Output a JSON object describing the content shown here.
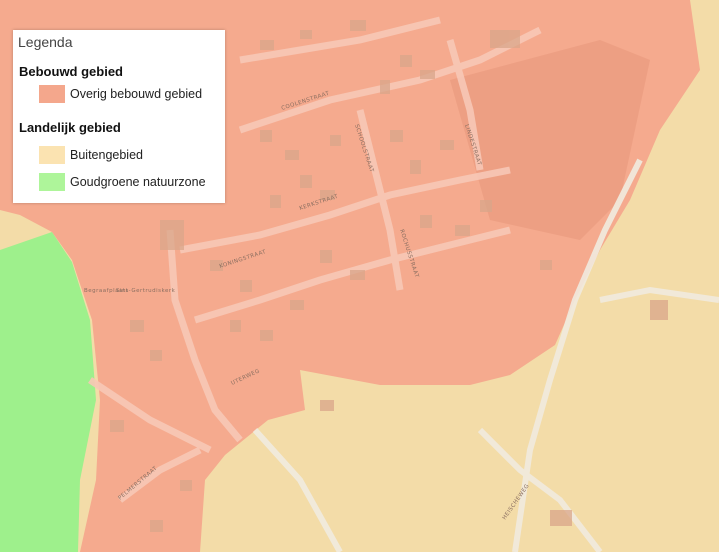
{
  "legend": {
    "title": "Legenda",
    "groups": [
      {
        "title": "Bebouwd gebied",
        "items": [
          {
            "label": "Overig bebouwd gebied",
            "color": "#f4a78c"
          }
        ]
      },
      {
        "title": "Landelijk gebied",
        "items": [
          {
            "label": "Buitengebied",
            "color": "#fbe3b1"
          },
          {
            "label": "Goudgroene natuurzone",
            "color": "#aef59a"
          }
        ]
      }
    ]
  },
  "map": {
    "colors": {
      "built": "#f4a78c",
      "rural": "#f3dca8",
      "nature": "#9ef08c",
      "road": "#f1ebdf",
      "building": "#d9a68a"
    },
    "labels": {
      "coolenstraat": "COOLENSTRAAT",
      "schoolstraat": "SCHOOLSTRAAT",
      "kerkstraat": "KERKSTRAAT",
      "koningsstraat": "KONINGSTRAAT",
      "rochusstraat": "ROCHUSSTRAAT",
      "lindestraat": "LINDESTRAAT",
      "uterweg": "UTERWEG",
      "pelmerstraat": "PELMERSTRAAT",
      "heischeweg": "HEISCHEWEG",
      "st_gertrudis": "Sint-Gertrudiskerk",
      "begraafplaats": "Begraafplaats"
    }
  }
}
